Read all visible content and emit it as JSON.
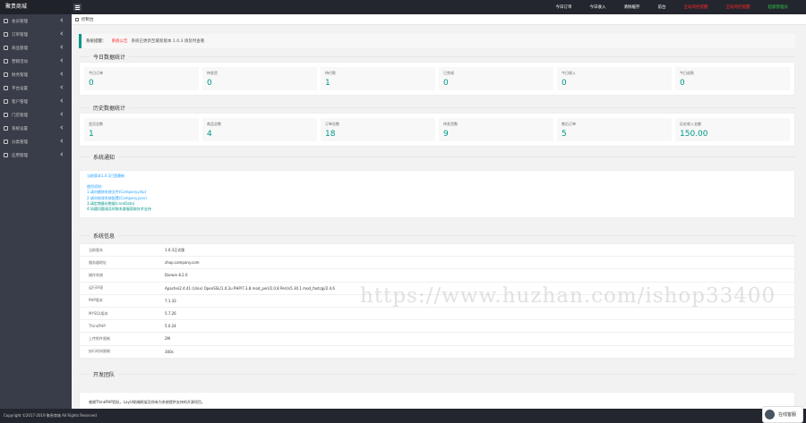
{
  "header": {
    "logo": "聚贵商城",
    "links": [
      {
        "label": "今日订单",
        "style": "normal"
      },
      {
        "label": "今日收入",
        "style": "normal"
      },
      {
        "label": "清除缓存",
        "style": "normal"
      },
      {
        "label": "前台",
        "style": "normal"
      },
      {
        "label": "全局风控提醒",
        "style": "red"
      },
      {
        "label": "全局风控提醒",
        "style": "red"
      },
      {
        "label": "超级管理员",
        "style": "green"
      }
    ]
  },
  "sidebar": {
    "items": [
      "会员管理",
      "订单管理",
      "商品管理",
      "营销活动",
      "财务管理",
      "平台设置",
      "客户管理",
      "门店管理",
      "系统设置",
      "分类管理",
      "应用管理"
    ]
  },
  "tab": {
    "label": "控制台"
  },
  "notice": {
    "label": "系统提醒：",
    "warn": "系统公告",
    "text": "系统已更新至最新版本 1.0.3 请及时查看"
  },
  "today": {
    "legend": "今日数据统计",
    "stats": [
      {
        "title": "今日订单",
        "value": "0"
      },
      {
        "title": "待发货",
        "value": "0"
      },
      {
        "title": "待付款",
        "value": "1"
      },
      {
        "title": "已完成",
        "value": "0"
      },
      {
        "title": "今日收入",
        "value": "0"
      },
      {
        "title": "今日退款",
        "value": "0"
      }
    ]
  },
  "history": {
    "legend": "历史数据统计",
    "stats": [
      {
        "title": "会员总数",
        "value": "1"
      },
      {
        "title": "商品总数",
        "value": "4"
      },
      {
        "title": "订单总数",
        "value": "18"
      },
      {
        "title": "待发货数",
        "value": "9"
      },
      {
        "title": "售后订单",
        "value": "5"
      },
      {
        "title": "历史收入金额",
        "value": "150.00"
      }
    ]
  },
  "sysinfo": {
    "legend": "系统通知",
    "first": "当前版本1.0.3已是最新",
    "lines": [
      "使用须知：",
      "1.请勿删除系统文件(Company.php)",
      "2.请勿修改系统配置(Company.json)",
      "3.请定期备份数据(cronData)",
      "4.如遇问题请及时联系客服获取技术支持"
    ]
  },
  "serverinfo": {
    "legend": "系统信息",
    "rows": [
      {
        "k": "当前版本",
        "v": "1.0.3正式版"
      },
      {
        "k": "服务器地址",
        "v": "shop.company.com"
      },
      {
        "k": "操作系统",
        "v": "Darwin 8.2.0"
      },
      {
        "k": "运行环境",
        "v": "Apache/2.4.41 (Unix) OpenSSL/1.0.2u PHP/7.3.8 mod_perl/2.0.8 Perl/v5.30.1 mod_fastcgi/2.4.6"
      },
      {
        "k": "PHP版本",
        "v": "7.1.33"
      },
      {
        "k": "MYSQL版本",
        "v": "5.7.26"
      },
      {
        "k": "ThinkPHP",
        "v": "5.0.24"
      },
      {
        "k": "上传附件限制",
        "v": "2M"
      },
      {
        "k": "执行时间限制",
        "v": "300s"
      }
    ]
  },
  "dev": {
    "legend": "开发团队",
    "text": "感谢ThinkPHP团队，LayUI前端框架及所有为系统提供支持的开源项目。"
  },
  "footer": {
    "text": "Copyright ©2017-2019 聚贵商城 All Rights Reserved"
  },
  "watermark": "https://www.huzhan.com/ishop33400",
  "service": {
    "label": "在线客服"
  }
}
